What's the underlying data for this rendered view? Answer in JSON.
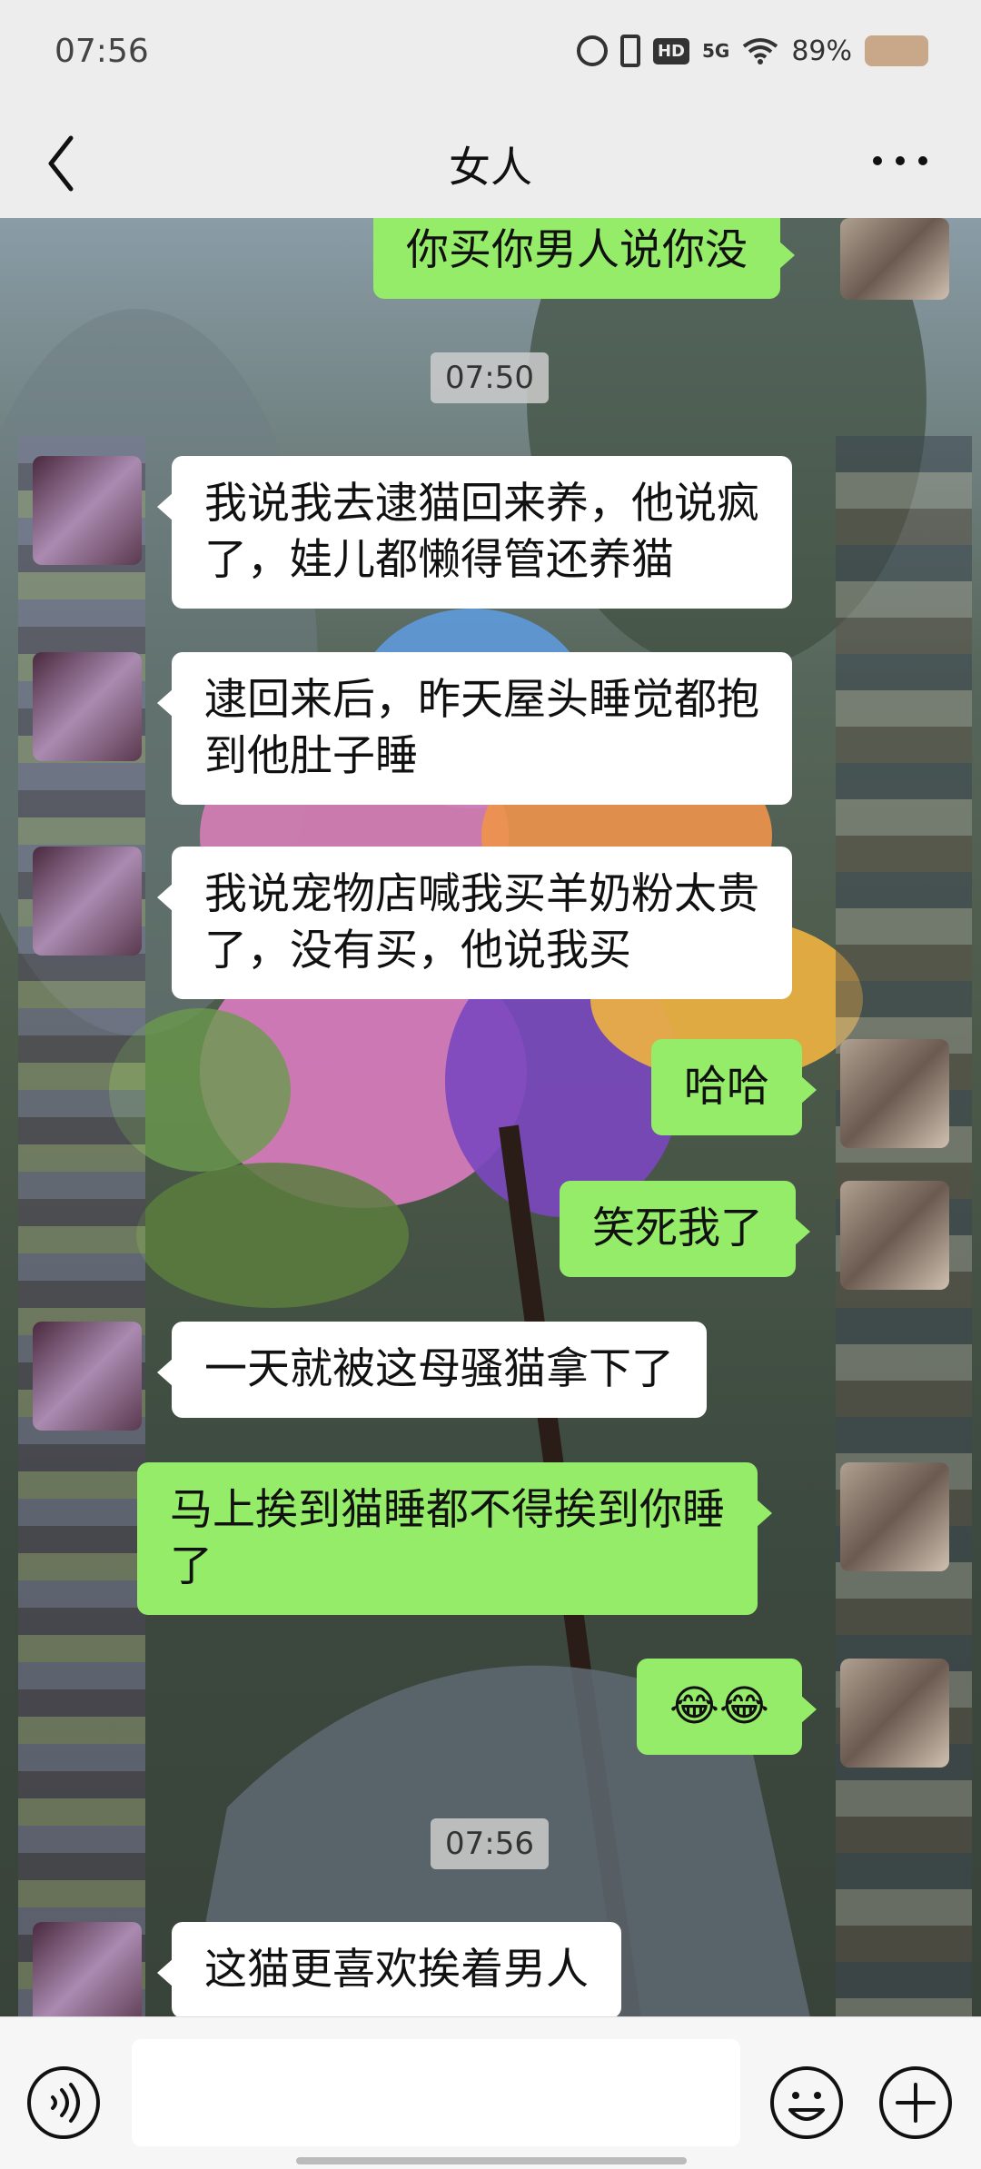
{
  "status_bar": {
    "time": "07:56",
    "network": "5G",
    "hd": "HD",
    "battery": "89%"
  },
  "nav": {
    "title": "女人"
  },
  "messages": [
    {
      "side": "right",
      "type": "text",
      "text": "你买你男人说你没"
    },
    {
      "type": "time",
      "text": "07:50"
    },
    {
      "side": "left",
      "type": "text",
      "lines": [
        "我说我去逮猫回来养，他说疯",
        "了，娃儿都懒得管还养猫"
      ]
    },
    {
      "side": "left",
      "type": "text",
      "lines": [
        "逮回来后，昨天屋头睡觉都抱",
        "到他肚子睡"
      ]
    },
    {
      "side": "left",
      "type": "text",
      "lines": [
        "我说宠物店喊我买羊奶粉太贵",
        "了，没有买，他说我买"
      ]
    },
    {
      "side": "right",
      "type": "text",
      "text": "哈哈"
    },
    {
      "side": "right",
      "type": "text",
      "text": "笑死我了"
    },
    {
      "side": "left",
      "type": "text",
      "text": "一天就被这母骚猫拿下了"
    },
    {
      "side": "right",
      "type": "text",
      "lines": [
        "马上挨到猫睡都不得挨到你睡",
        "了"
      ]
    },
    {
      "side": "right",
      "type": "emoji",
      "text": "😂😂"
    },
    {
      "type": "time",
      "text": "07:56"
    },
    {
      "side": "left",
      "type": "text",
      "text": "这猫更喜欢挨着男人"
    }
  ],
  "icons": {
    "back": "chevron-left-icon",
    "more": "more-dots-icon",
    "voice": "voice-icon",
    "emoji": "emoji-icon",
    "plus": "plus-icon"
  },
  "colors": {
    "self_bubble": "#95ec69",
    "other_bubble": "#ffffff",
    "bar_bg": "#ededed"
  }
}
